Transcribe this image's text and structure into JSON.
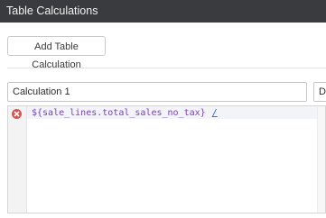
{
  "window": {
    "title": "Table Calculations"
  },
  "toolbar": {
    "add_label": "Add Table Calculation"
  },
  "calculation": {
    "name": "Calculation 1",
    "format_value": "De",
    "expression": "${sale_lines.total_sales_no_tax}",
    "operator": "/",
    "error_icon": "error-circle-icon",
    "colors": {
      "error": "#d9534f",
      "expression": "#7a3fb5",
      "operator": "#2c5bd6"
    }
  }
}
